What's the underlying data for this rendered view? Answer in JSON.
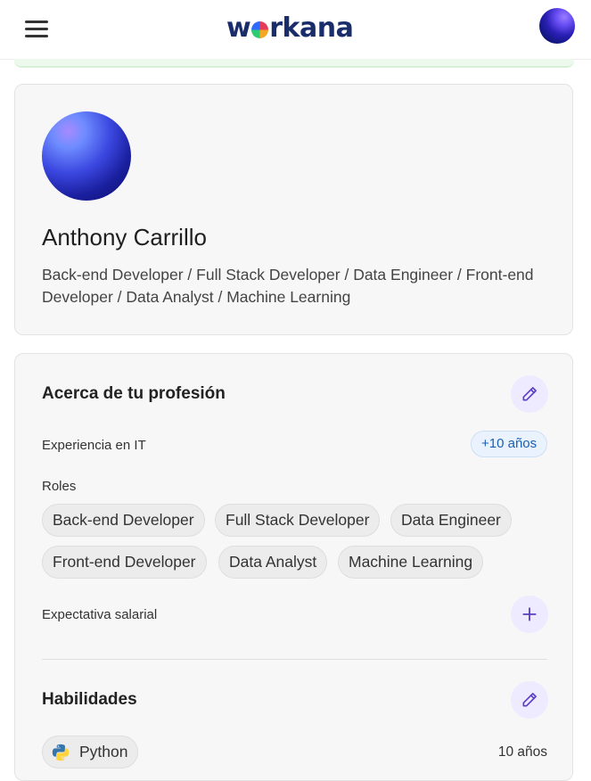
{
  "header": {
    "logo": {
      "before": "w",
      "after": "rkana"
    },
    "menu_icon": "hamburger-icon",
    "avatar": "user-avatar"
  },
  "profile": {
    "name": "Anthony Carrillo",
    "headline": "Back-end Developer / Full Stack Developer / Data Engineer / Front-end Developer / Data Analyst / Machine Learning"
  },
  "profession": {
    "title": "Acerca de tu profesión",
    "experience_label": "Experiencia en IT",
    "experience_value": "+10 años",
    "roles_label": "Roles",
    "roles": [
      "Back-end Developer",
      "Full Stack Developer",
      "Data Engineer",
      "Front-end Developer",
      "Data Analyst",
      "Machine Learning"
    ],
    "salary_label": "Expectativa salarial"
  },
  "skills": {
    "title": "Habilidades",
    "items": [
      {
        "name": "Python",
        "years": "10 años",
        "icon": "python-icon"
      }
    ]
  },
  "colors": {
    "accent": "#5b3fc4",
    "edit_bg": "#eeeaff",
    "badge_text": "#1a5fb4",
    "logo_text": "#1a2d6b"
  }
}
